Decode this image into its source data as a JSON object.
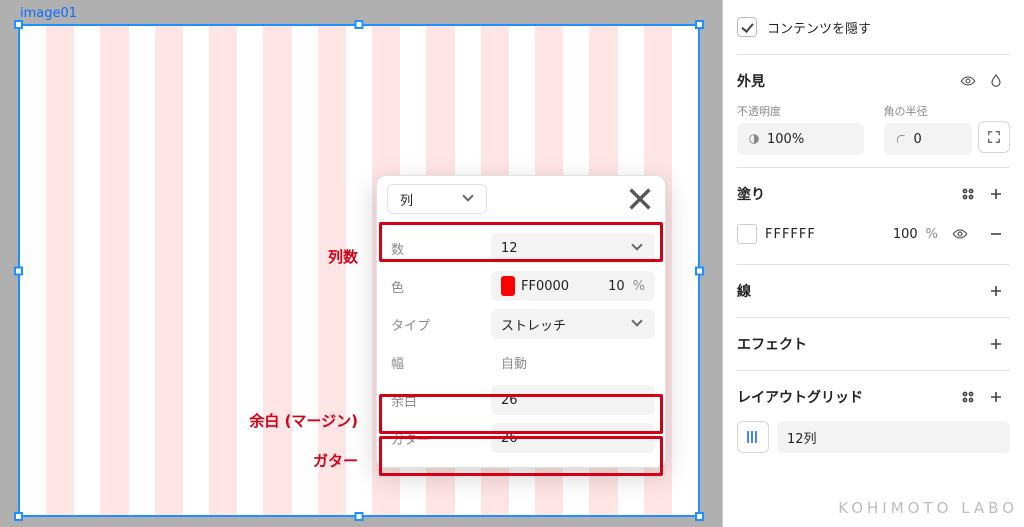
{
  "canvas": {
    "frame_label": "image01"
  },
  "annotations": {
    "columns": "列数",
    "margin": "余白 (マージン)",
    "gutter": "ガター"
  },
  "popover": {
    "type_value": "列",
    "count_label": "数",
    "count_value": "12",
    "color_label": "色",
    "color_hex": "FF0000",
    "color_opacity": "10",
    "opacity_unit": "%",
    "type_label": "タイプ",
    "type_mode": "ストレッチ",
    "width_label": "幅",
    "width_value": "自動",
    "margin_label": "余白",
    "margin_value": "26",
    "gutter_label": "ガター",
    "gutter_value": "26"
  },
  "inspector": {
    "clip_label": "コンテンツを隠す",
    "appearance_title": "外見",
    "opacity_label": "不透明度",
    "opacity_value": "100%",
    "radius_label": "角の半径",
    "radius_value": "0",
    "fill_title": "塗り",
    "fill_hex": "FFFFFF",
    "fill_opacity": "100",
    "fill_unit": "%",
    "stroke_title": "線",
    "effect_title": "エフェクト",
    "grid_title": "レイアウトグリッド",
    "grid_item": "12列"
  },
  "watermark": "KOHIMOTO LABO"
}
